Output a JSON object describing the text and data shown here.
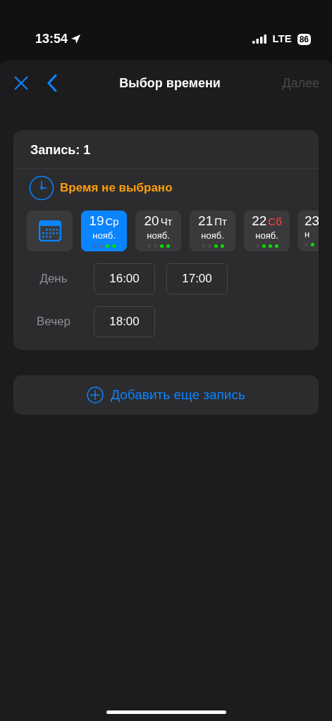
{
  "status_bar": {
    "time": "13:54",
    "network": "LTE",
    "battery": "86"
  },
  "nav": {
    "title": "Выбор времени",
    "next": {
      "label": "Далее",
      "disabled": true
    }
  },
  "record": {
    "title": "Запись: 1",
    "status": "Время не выбрано",
    "dates": [
      {
        "kind": "full",
        "day": "19",
        "weekday": "Ср",
        "month": "нояб.",
        "selected": true,
        "color": "#ffffff",
        "slots": [
          {
            "available": false
          },
          {
            "available": false
          },
          {
            "available": true
          },
          {
            "available": true
          }
        ]
      },
      {
        "kind": "full",
        "day": "20",
        "weekday": "Чт",
        "month": "нояб.",
        "selected": false,
        "color": "#ffffff",
        "slots": [
          {
            "available": false
          },
          {
            "available": false
          },
          {
            "available": true
          },
          {
            "available": true
          }
        ]
      },
      {
        "kind": "full",
        "day": "21",
        "weekday": "Пт",
        "month": "нояб.",
        "selected": false,
        "color": "#ffffff",
        "slots": [
          {
            "available": false
          },
          {
            "available": false
          },
          {
            "available": true
          },
          {
            "available": true
          }
        ]
      },
      {
        "kind": "full",
        "day": "22",
        "weekday": "Сб",
        "month": "нояб.",
        "selected": false,
        "color": "#ff453a",
        "slots": [
          {
            "available": false
          },
          {
            "available": true
          },
          {
            "available": true
          },
          {
            "available": true
          }
        ]
      },
      {
        "kind": "partial",
        "day": "23",
        "month": "н",
        "selected": false,
        "slots": [
          {
            "available": false
          },
          {
            "available": true
          }
        ]
      }
    ],
    "periods": [
      {
        "label": "День",
        "times": [
          "16:00",
          "17:00"
        ]
      },
      {
        "label": "Вечер",
        "times": [
          "18:00"
        ]
      }
    ]
  },
  "add_button": "Добавить еще запись"
}
